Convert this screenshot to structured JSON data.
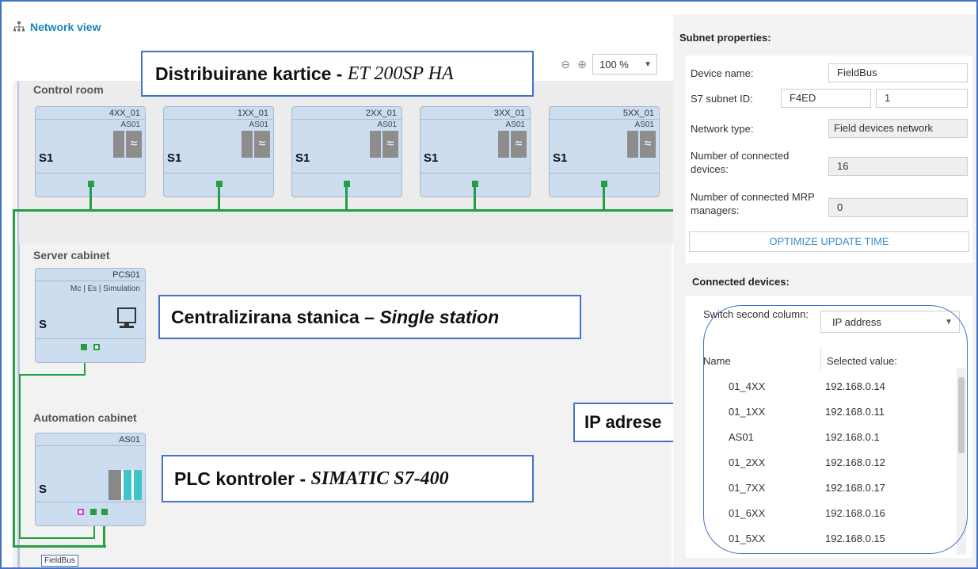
{
  "network_view": {
    "title": "Network view",
    "zoom": {
      "value": "100 %"
    }
  },
  "sections": {
    "control_room": "Control room",
    "server_cabinet": "Server cabinet",
    "automation_cabinet": "Automation cabinet"
  },
  "control_room_devices": [
    {
      "name": "4XX_01",
      "sub": "AS01",
      "label": "S1"
    },
    {
      "name": "1XX_01",
      "sub": "AS01",
      "label": "S1"
    },
    {
      "name": "2XX_01",
      "sub": "AS01",
      "label": "S1"
    },
    {
      "name": "3XX_01",
      "sub": "AS01",
      "label": "S1"
    },
    {
      "name": "5XX_01",
      "sub": "AS01",
      "label": "S1"
    }
  ],
  "server_device": {
    "name": "PCS01",
    "sub": "Mc | Es | Simulation",
    "label": "S"
  },
  "automation_device": {
    "name": "AS01",
    "label": "S"
  },
  "bus_label": "FieldBus",
  "annotations": {
    "distributed_prefix": "Distribuirane kartice - ",
    "distributed_italic": "ET 200SP HA",
    "central_prefix": "Centralizirana stanica – ",
    "central_italic": "Single station",
    "plc_prefix": "PLC kontroler - ",
    "plc_italic": "SIMATIC S7-400",
    "ip": "IP adrese"
  },
  "subnet_properties": {
    "title": "Subnet properties:",
    "device_name_label": "Device name:",
    "device_name_value": "FieldBus",
    "subnet_id_label": "S7 subnet ID:",
    "subnet_id_a": "F4ED",
    "subnet_id_b": "1",
    "network_type_label": "Network type:",
    "network_type_value": "Field devices network",
    "connected_devices_label": "Number of connected devices:",
    "connected_devices_value": "16",
    "mrp_label": "Number of connected MRP managers:",
    "mrp_value": "0",
    "optimize_button": "OPTIMIZE UPDATE TIME"
  },
  "connected_devices": {
    "title": "Connected devices:",
    "switch_label": "Switch second column:",
    "switch_value": "IP address",
    "col_name": "Name",
    "col_value": "Selected value:",
    "rows": [
      {
        "name": "01_4XX",
        "value": "192.168.0.14"
      },
      {
        "name": "01_1XX",
        "value": "192.168.0.11"
      },
      {
        "name": "AS01",
        "value": "192.168.0.1"
      },
      {
        "name": "01_2XX",
        "value": "192.168.0.12"
      },
      {
        "name": "01_7XX",
        "value": "192.168.0.17"
      },
      {
        "name": "01_6XX",
        "value": "192.168.0.16"
      },
      {
        "name": "01_5XX",
        "value": "192.168.0.15"
      }
    ]
  },
  "colors": {
    "bus": "#22a040",
    "accent": "#4472c4",
    "device": "#cdddf0"
  }
}
